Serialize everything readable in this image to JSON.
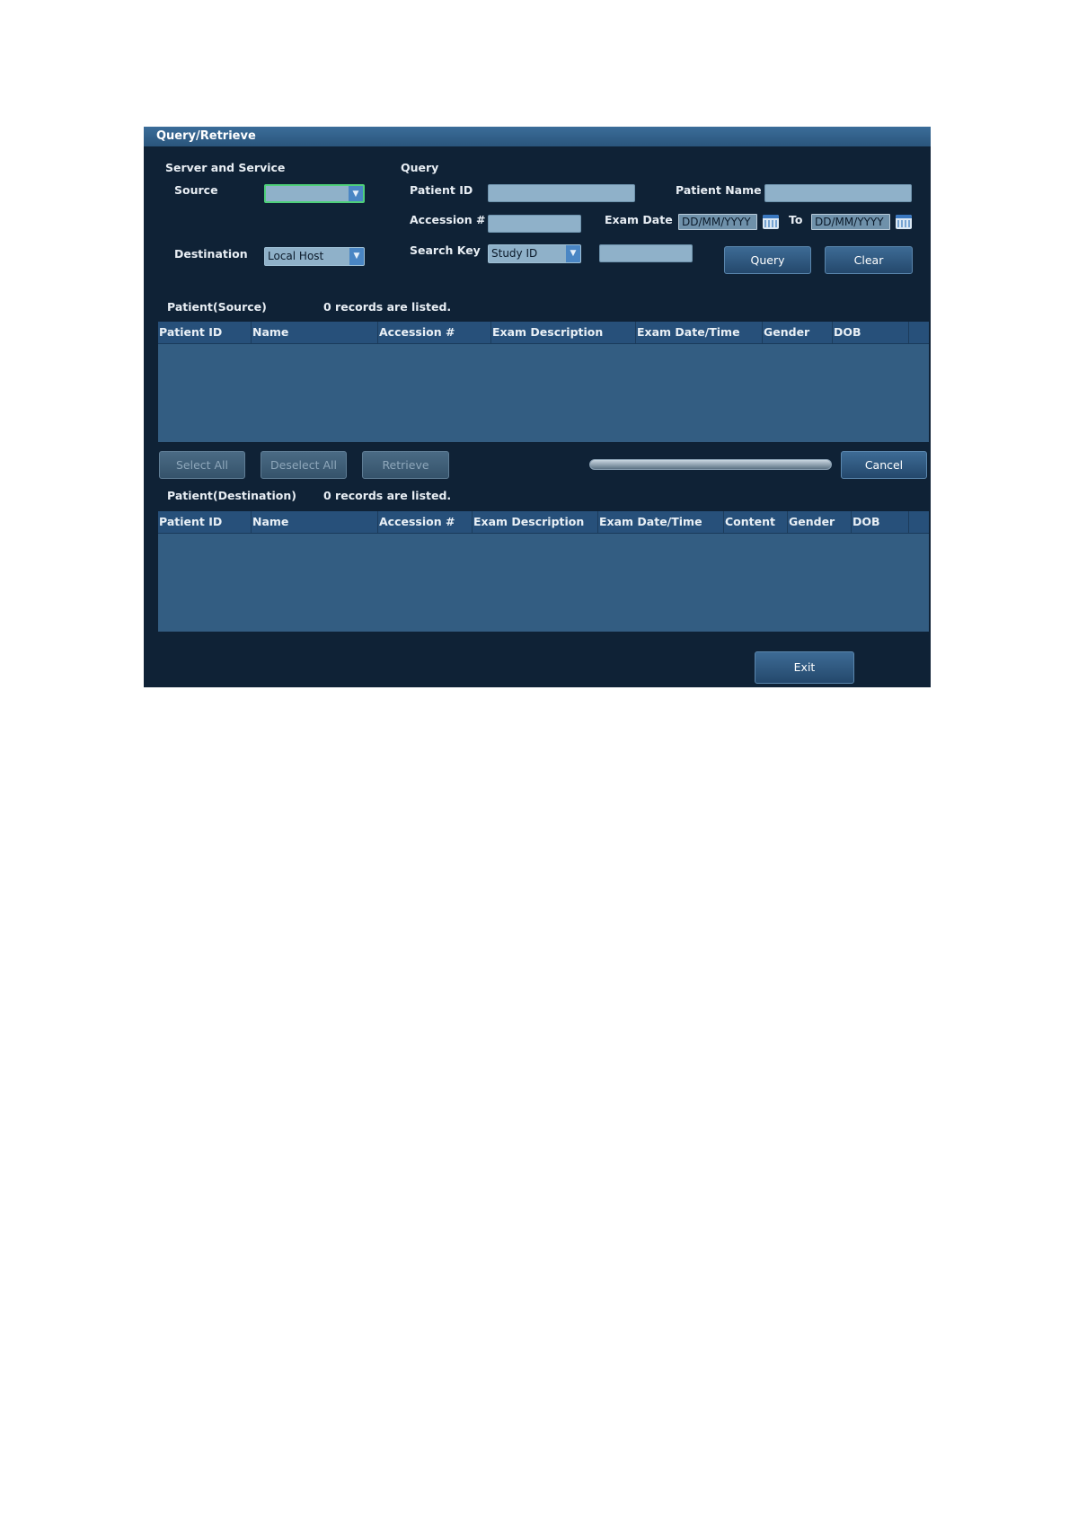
{
  "window": {
    "title": "Query/Retrieve"
  },
  "server": {
    "section_label": "Server and Service",
    "source_label": "Source",
    "source_value": "",
    "destination_label": "Destination",
    "destination_value": "Local Host"
  },
  "query": {
    "section_label": "Query",
    "patient_id_label": "Patient ID",
    "patient_id_value": "",
    "patient_name_label": "Patient Name",
    "patient_name_value": "",
    "accession_label": "Accession #",
    "accession_value": "",
    "exam_date_label": "Exam Date",
    "exam_date_from": "DD/MM/YYYY",
    "to_label": "To",
    "exam_date_to": "DD/MM/YYYY",
    "search_key_label": "Search Key",
    "search_key_value": "Study ID",
    "search_value": "",
    "query_button": "Query",
    "clear_button": "Clear"
  },
  "source_list": {
    "label": "Patient(Source)",
    "count_text": "0 records are listed.",
    "columns": [
      "Patient ID",
      "Name",
      "Accession #",
      "Exam Description",
      "Exam Date/Time",
      "Gender",
      "DOB"
    ],
    "rows": []
  },
  "actions": {
    "select_all": "Select All",
    "deselect_all": "Deselect All",
    "retrieve": "Retrieve",
    "cancel": "Cancel",
    "progress": 0
  },
  "destination_list": {
    "label": "Patient(Destination)",
    "count_text": "0 records are listed.",
    "columns": [
      "Patient ID",
      "Name",
      "Accession #",
      "Exam Description",
      "Exam Date/Time",
      "Content",
      "Gender",
      "DOB"
    ],
    "rows": []
  },
  "footer": {
    "exit_button": "Exit"
  },
  "icons": {
    "dropdown": "chevron-down-icon",
    "calendar": "calendar-icon"
  },
  "colors": {
    "window_bg": "#0f2236",
    "title_bar": "#2f5f8a",
    "table_body": "#335d82",
    "input_bg": "#8fb1c9",
    "focus": "#4ed07a"
  }
}
